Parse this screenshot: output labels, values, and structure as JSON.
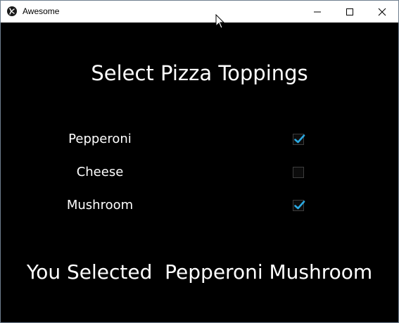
{
  "window": {
    "title": "Awesome",
    "icon": "kivy-icon",
    "controls": {
      "minimize_icon": "minimize-icon",
      "maximize_icon": "maximize-icon",
      "close_icon": "close-icon"
    }
  },
  "main": {
    "heading": "Select Pizza Toppings",
    "toppings": [
      {
        "label": "Pepperoni",
        "checked": true
      },
      {
        "label": "Cheese",
        "checked": false
      },
      {
        "label": "Mushroom",
        "checked": true
      }
    ],
    "result_text": "You Selected  Pepperoni Mushroom"
  },
  "colors": {
    "background": "#000000",
    "text": "#ffffff",
    "checkmark": "#2ba8e0",
    "titlebar": "#ffffff"
  }
}
